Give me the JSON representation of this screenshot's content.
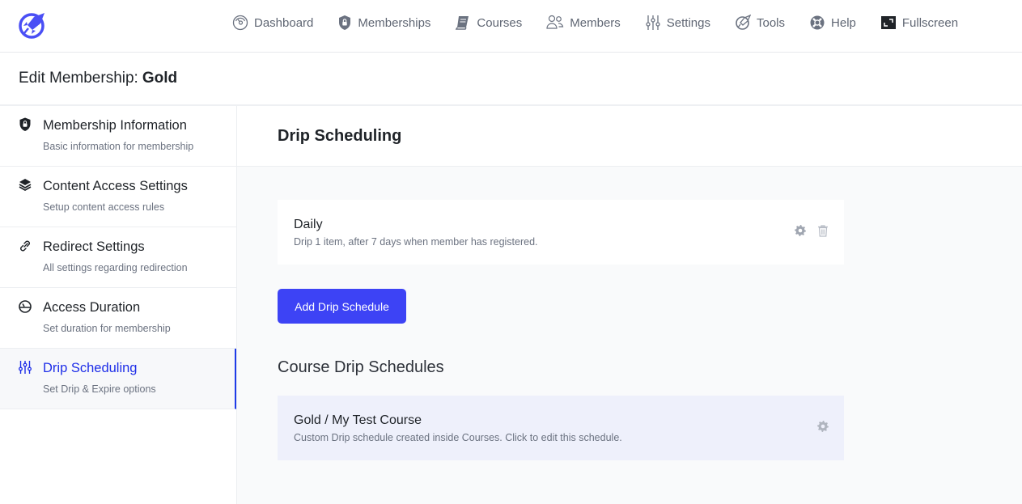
{
  "topnav": {
    "logo": "rocket-logo",
    "items": [
      {
        "label": "Dashboard",
        "icon": "speedometer-icon"
      },
      {
        "label": "Memberships",
        "icon": "shield-lock-icon"
      },
      {
        "label": "Courses",
        "icon": "book-icon"
      },
      {
        "label": "Members",
        "icon": "users-icon"
      },
      {
        "label": "Settings",
        "icon": "sliders-icon"
      },
      {
        "label": "Tools",
        "icon": "rocket-icon"
      },
      {
        "label": "Help",
        "icon": "lifebuoy-icon"
      },
      {
        "label": "Fullscreen",
        "icon": "fullscreen-icon"
      }
    ]
  },
  "header": {
    "prefix": "Edit Membership:",
    "name": "Gold"
  },
  "sidebar": {
    "items": [
      {
        "title": "Membership Information",
        "subtitle": "Basic information for membership",
        "icon": "shield-lock-icon"
      },
      {
        "title": "Content Access Settings",
        "subtitle": "Setup content access rules",
        "icon": "layers-icon"
      },
      {
        "title": "Redirect Settings",
        "subtitle": "All settings regarding redirection",
        "icon": "link-icon"
      },
      {
        "title": "Access Duration",
        "subtitle": "Set duration for membership",
        "icon": "clock-icon"
      },
      {
        "title": "Drip Scheduling",
        "subtitle": "Set Drip & Expire options",
        "icon": "sliders-icon",
        "active": true
      }
    ]
  },
  "main": {
    "title": "Drip Scheduling",
    "schedules": [
      {
        "title": "Daily",
        "description": "Drip 1 item, after 7 days when member has registered."
      }
    ],
    "add_button": "Add Drip Schedule",
    "course_section_title": "Course Drip Schedules",
    "course_schedules": [
      {
        "title": "Gold / My Test Course",
        "description": "Custom Drip schedule created inside Courses. Click to edit this schedule."
      }
    ]
  },
  "colors": {
    "accent": "#3d43f5",
    "active_nav": "#1e2ee8",
    "logo": "#4a4ff5"
  }
}
